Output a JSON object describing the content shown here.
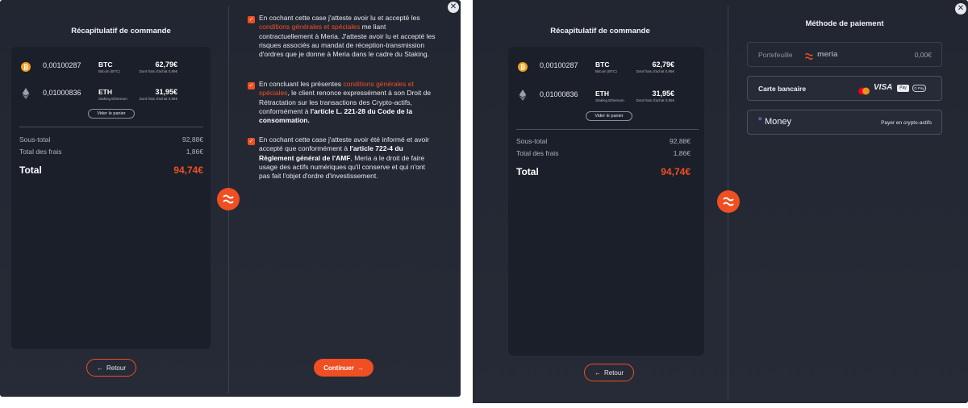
{
  "summary": {
    "title": "Récapitulatif de commande",
    "assets": [
      {
        "qty": "0,00100287",
        "symbol": "BTC",
        "subtitle": "Bitcoin (BTC)",
        "price": "62,79€",
        "fee": "Dont frais d'achat 0,95€",
        "icon": "bitcoin-icon"
      },
      {
        "qty": "0,01000836",
        "symbol": "ETH",
        "subtitle": "Staking Ethereum",
        "price": "31,95€",
        "fee": "Dont frais d'achat 0,95€",
        "icon": "ethereum-icon"
      }
    ],
    "empty_cart": "Vider le panier",
    "subtotal_label": "Sous-total",
    "subtotal_value": "92,88€",
    "fees_label": "Total des frais",
    "fees_value": "1,86€",
    "total_label": "Total",
    "total_value": "94,74€",
    "back_label": "Retour"
  },
  "terms": {
    "continue_label": "Continuer",
    "items": [
      {
        "checked": true,
        "parts": [
          {
            "t": "En cochant cette case j'atteste avoir lu et accepté les "
          },
          {
            "t": "conditions générales et spéciales",
            "s": "link"
          },
          {
            "t": " me liant contractuellement à Meria. J'atteste avoir lu et accepté les risques associés au mandat de réception-transmission d'ordres que je donne à Meria dans le cadre du Staking."
          }
        ]
      },
      {
        "checked": true,
        "parts": [
          {
            "t": "En concluant les présentes "
          },
          {
            "t": "conditions générales et spéciales",
            "s": "link"
          },
          {
            "t": ", le client renonce expressément à son Droit de Rétractation sur les transactions des Crypto-actifs, conformément à "
          },
          {
            "t": "l'article L. 221-28 du Code de la consommation.",
            "s": "bold"
          }
        ]
      },
      {
        "checked": true,
        "parts": [
          {
            "t": "En cochant cette case j'atteste avoir été informé et avoir accepté que conformément à "
          },
          {
            "t": "l'article 722-4 du Règlement général de l'AMF",
            "s": "bold"
          },
          {
            "t": ", Meria a le droit de faire usage des actifs numériques qu'il conserve et qui n'ont pas fait l'objet d'ordre d'investissement."
          }
        ]
      }
    ]
  },
  "payment": {
    "title": "Méthode de paiement",
    "wallet_label": "Portefeuille",
    "wallet_brand": "meria",
    "wallet_balance": "0,00€",
    "card_label": "Carte bancaire",
    "card_brands": [
      "mastercard-icon",
      "visa-icon",
      "apple-pay-icon",
      "google-pay-icon"
    ],
    "visa_text": "VISA",
    "applepay_text": "Pay",
    "gpay_text": "G Pay",
    "crypto_brand": "Money",
    "crypto_label": "Payer en crypto-actifs"
  },
  "colors": {
    "accent": "#ef4f22",
    "panel": "#242833",
    "box": "#1b1f29"
  }
}
